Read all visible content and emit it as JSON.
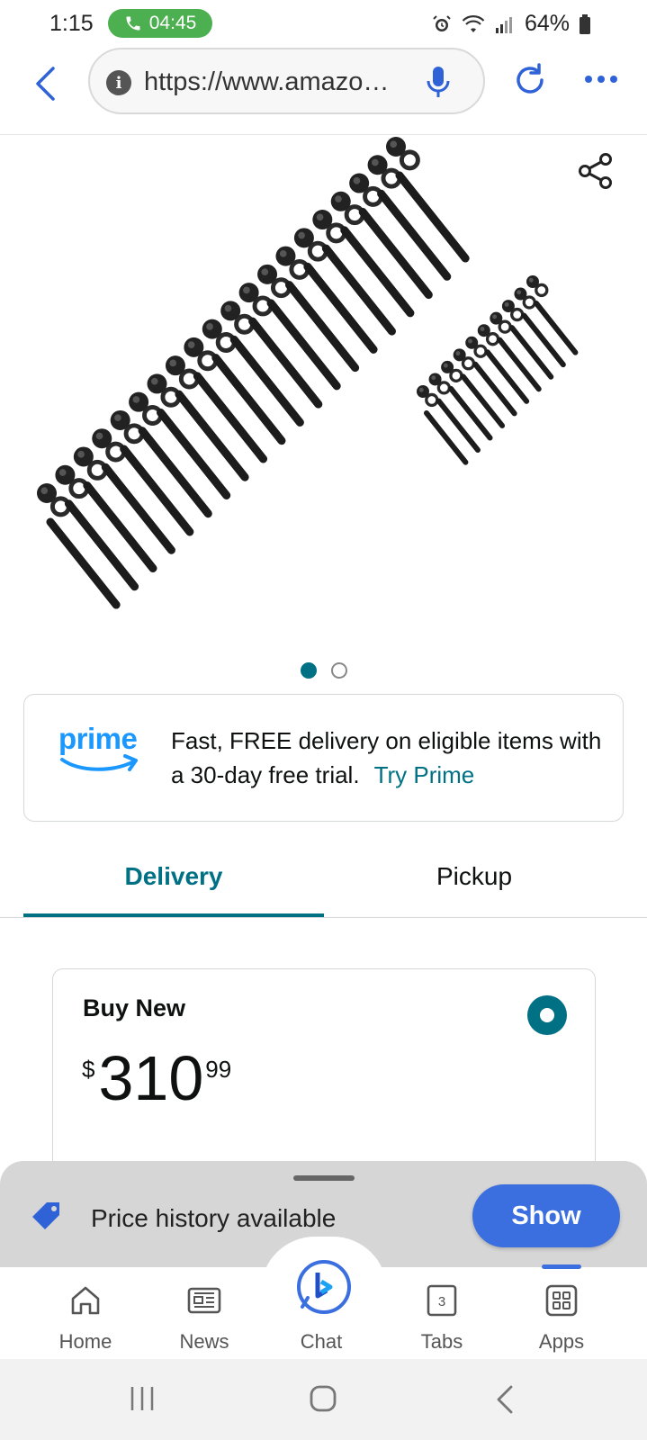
{
  "status_bar": {
    "time": "1:15",
    "call_timer": "04:45",
    "battery": "64%"
  },
  "browser": {
    "url": "https://www.amazo…",
    "back_icon": "chevron-left-icon",
    "info_icon": "info-icon",
    "mic_icon": "microphone-icon",
    "refresh_icon": "refresh-icon",
    "more_icon": "more-dots-icon"
  },
  "product": {
    "image_alt": "head studs kit",
    "carousel_total": 2,
    "carousel_active": 1
  },
  "prime_banner": {
    "logo_text": "prime",
    "text": "Fast, FREE delivery on eligible items with a 30-day free trial.",
    "link": "Try Prime"
  },
  "tabs": [
    {
      "label": "Delivery",
      "active": true
    },
    {
      "label": "Pickup",
      "active": false
    }
  ],
  "buy_box": {
    "label": "Buy New",
    "currency": "$",
    "price_whole": "310",
    "price_fraction": "99"
  },
  "price_history": {
    "text": "Price history available",
    "button": "Show"
  },
  "bottom_nav": [
    {
      "label": "Home",
      "icon": "home-icon"
    },
    {
      "label": "News",
      "icon": "news-icon"
    },
    {
      "label": "Chat",
      "icon": "bing-chat-icon"
    },
    {
      "label": "Tabs",
      "icon": "tabs-icon",
      "count": "3"
    },
    {
      "label": "Apps",
      "icon": "apps-icon"
    }
  ],
  "colors": {
    "accent_teal": "#007185",
    "prime_blue": "#1a98ff",
    "button_blue": "#3b6fe0",
    "call_green": "#4caf50"
  }
}
